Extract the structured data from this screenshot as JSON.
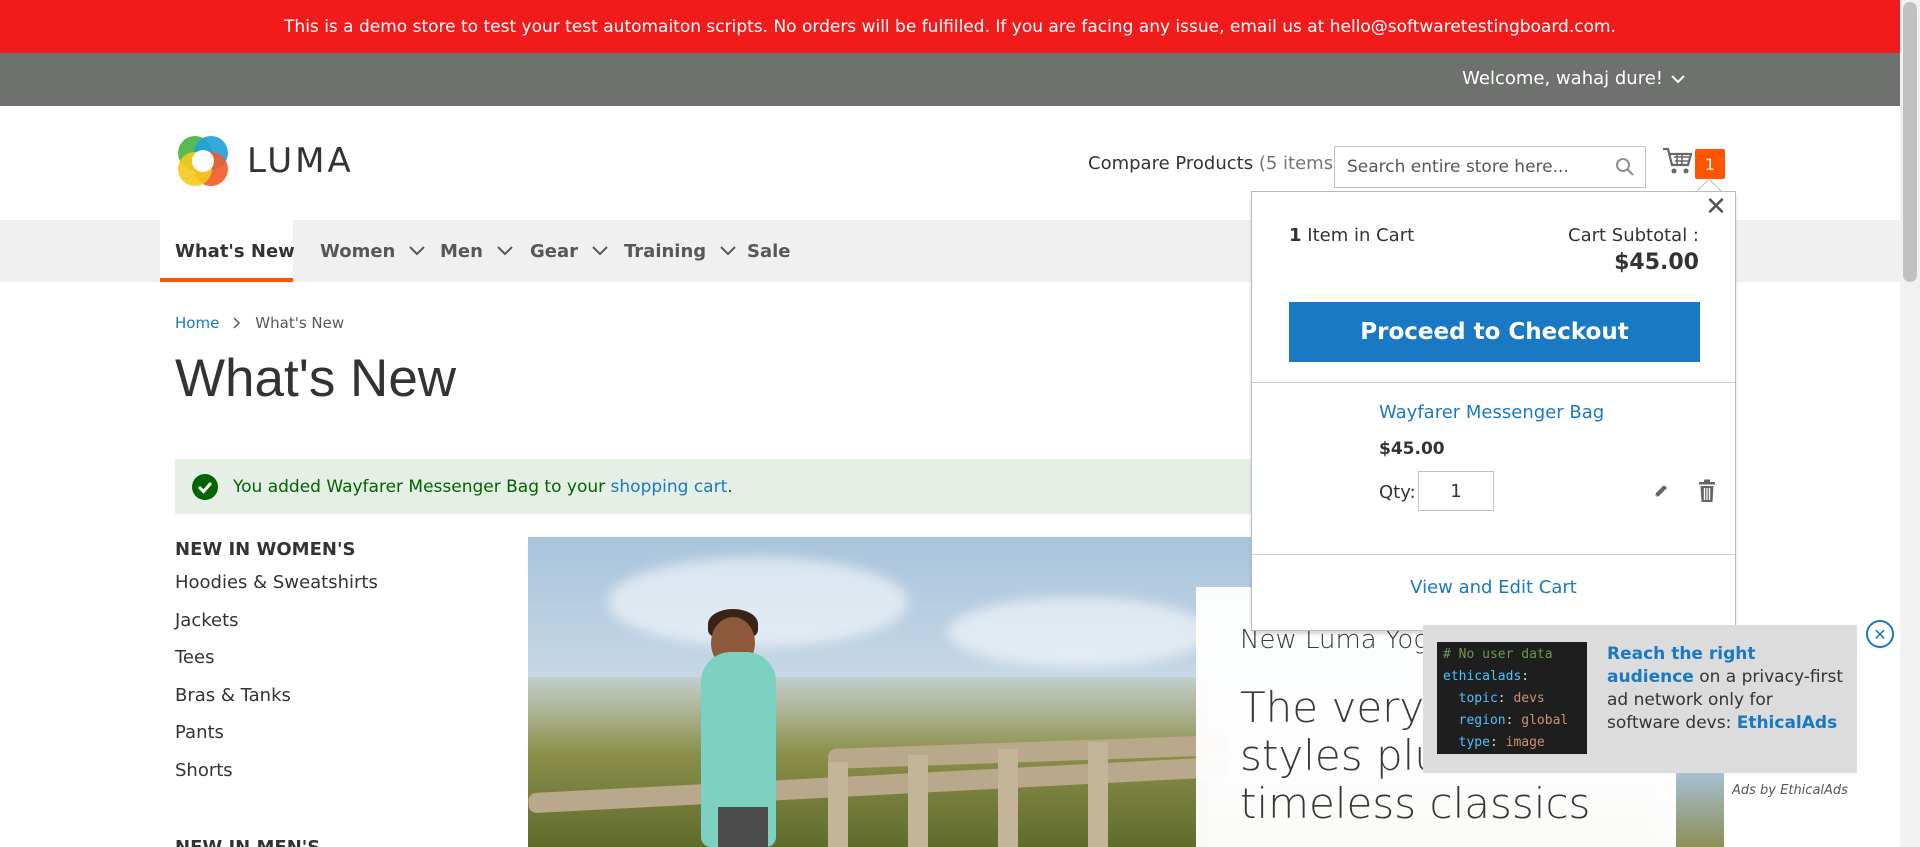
{
  "banner": {
    "text": "This is a demo store to test your test automaiton scripts. No orders will be fulfilled. If you are facing any issue, email us at hello@softwaretestingboard.com."
  },
  "topbar": {
    "welcome": "Welcome, wahaj dure!"
  },
  "header": {
    "logo_text": "LUMA",
    "compare_label": "Compare Products",
    "compare_count": "(5 items)",
    "search_placeholder": "Search entire store here...",
    "cart_count": "1"
  },
  "nav": {
    "items": [
      {
        "label": "What's New"
      },
      {
        "label": "Women"
      },
      {
        "label": "Men"
      },
      {
        "label": "Gear"
      },
      {
        "label": "Training"
      },
      {
        "label": "Sale"
      }
    ]
  },
  "breadcrumb": {
    "home": "Home",
    "current": "What's New"
  },
  "page": {
    "title": "What's New"
  },
  "message": {
    "prefix": "You added Wayfarer Messenger Bag to your",
    "link": "shopping cart",
    "suffix": "."
  },
  "sidebar": {
    "title": "NEW IN WOMEN'S",
    "items": [
      "Hoodies & Sweatshirts",
      "Jackets",
      "Tees",
      "Bras & Tanks",
      "Pants",
      "Shorts"
    ],
    "title2": "NEW IN MEN'S"
  },
  "promo": {
    "subtitle": "New Luma Yog",
    "title_line1": "The very la",
    "title_line2": "styles plus",
    "title_line3": "timeless classics"
  },
  "minicart": {
    "count_num": "1",
    "count_label": "Item in Cart",
    "subtotal_label": "Cart Subtotal :",
    "subtotal_value": "$45.00",
    "checkout_label": "Proceed to Checkout",
    "product_name": "Wayfarer Messenger Bag",
    "product_price": "$45.00",
    "qty_label": "Qty:",
    "qty_value": "1",
    "view_edit": "View and Edit Cart"
  },
  "ad": {
    "code_line1": "# No user data",
    "code_key1": "ethicalads",
    "code_key2": "topic",
    "code_val2": "devs",
    "code_key3": "region",
    "code_val3": "global",
    "code_key4": "type",
    "code_val4": "image",
    "text_highlight": "Reach the right audience",
    "text_body": " on a privacy-first ad network only for software devs: ",
    "text_brand": "EthicalAds",
    "ads_by": "Ads by EthicalAds"
  },
  "colors": {
    "banner_red": "#f21b1b",
    "topbar_gray": "#6e716e",
    "link_blue": "#1979c3",
    "accent_orange": "#ff5501",
    "success_bg": "#e5efe5"
  }
}
